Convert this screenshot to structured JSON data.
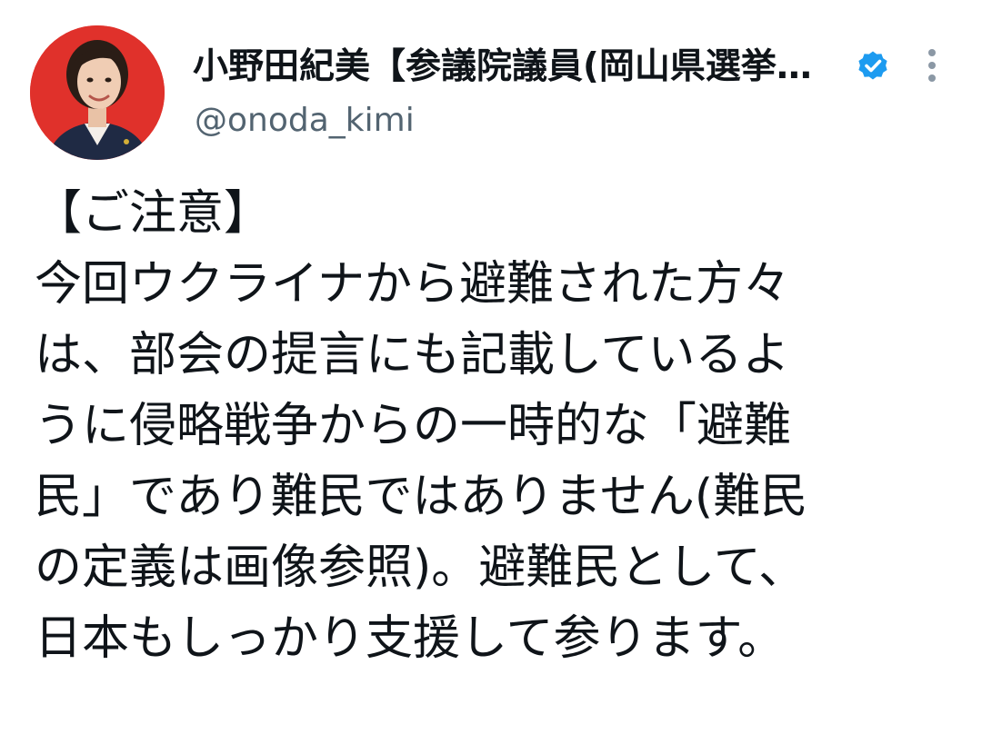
{
  "author": {
    "display_name": "小野田紀美【参議院議員(岡山県選挙…",
    "handle": "@onoda_kimi",
    "verified": true,
    "avatar_background": "#e0312b",
    "verified_color": "#1d9bf0"
  },
  "tweet": {
    "lines": [
      "【ご注意】",
      "今回ウクライナから避難された方々",
      "は、部会の提言にも記載しているよ",
      "うに侵略戦争からの一時的な「避難",
      "民」であり難民ではありません(難民",
      "の定義は画像参照)。避難民として、",
      "日本もしっかり支援して参ります。"
    ]
  },
  "icons": {
    "verified": "verified-badge-icon",
    "more": "more-options-icon"
  }
}
